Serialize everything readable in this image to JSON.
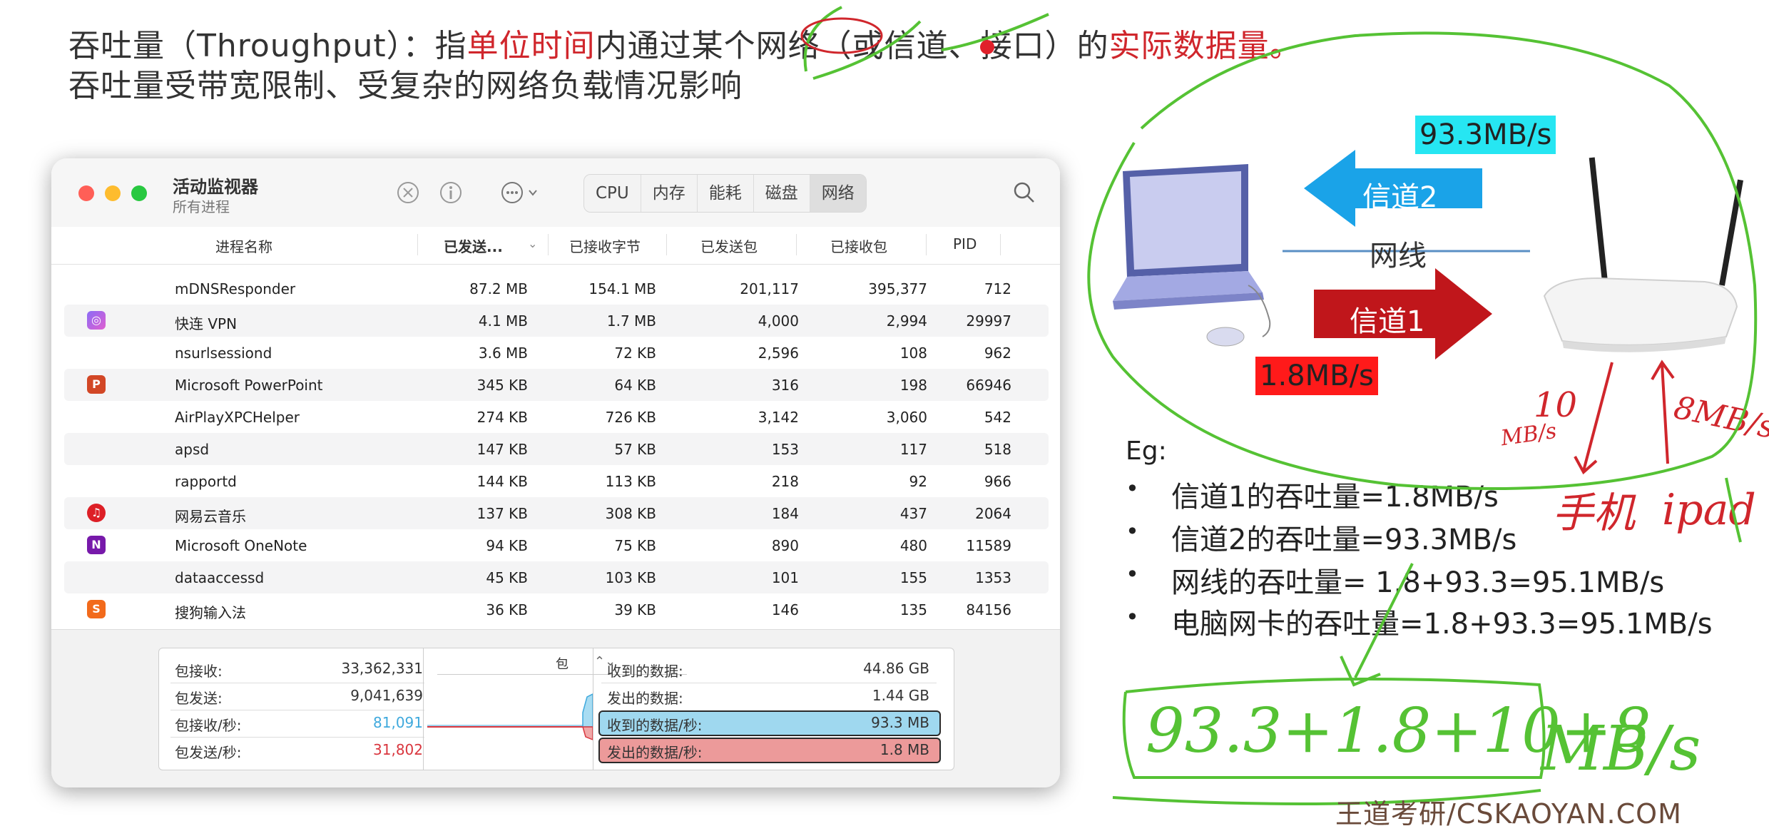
{
  "header": {
    "line1": [
      {
        "text": "吞吐量（Throughput）：指",
        "color": "normal"
      },
      {
        "text": "单位时间",
        "color": "red"
      },
      {
        "text": "内通过某个网络（或信道、接口）的",
        "color": "normal"
      },
      {
        "text": "实际数据量",
        "color": "red"
      },
      {
        "text": "。",
        "color": "red"
      }
    ],
    "line2": "吞吐量受带宽限制、受复杂的网络负载情况影响"
  },
  "window": {
    "title": "活动监视器",
    "subtitle": "所有进程",
    "tabs": [
      "CPU",
      "内存",
      "能耗",
      "磁盘",
      "网络"
    ],
    "active_tab": "网络",
    "columns": [
      "进程名称",
      "已发送...",
      "已接收字节",
      "已发送包",
      "已接收包",
      "PID"
    ],
    "processes": [
      {
        "name": "mDNSResponder",
        "icon": "",
        "sent": "87.2 MB",
        "recv": "154.1 MB",
        "pkt_out": "201,117",
        "pkt_in": "395,377",
        "pid": "712"
      },
      {
        "name": "快连 VPN",
        "icon": "vpn-app-icon",
        "sent": "4.1 MB",
        "recv": "1.7 MB",
        "pkt_out": "4,000",
        "pkt_in": "2,994",
        "pid": "29997"
      },
      {
        "name": "nsurlsessiond",
        "icon": "",
        "sent": "3.6 MB",
        "recv": "72 KB",
        "pkt_out": "2,596",
        "pkt_in": "108",
        "pid": "962"
      },
      {
        "name": "Microsoft PowerPoint",
        "icon": "powerpoint-icon",
        "sent": "345 KB",
        "recv": "64 KB",
        "pkt_out": "316",
        "pkt_in": "198",
        "pid": "66946"
      },
      {
        "name": "AirPlayXPCHelper",
        "icon": "",
        "sent": "274 KB",
        "recv": "726 KB",
        "pkt_out": "3,142",
        "pkt_in": "3,060",
        "pid": "542"
      },
      {
        "name": "apsd",
        "icon": "",
        "sent": "147 KB",
        "recv": "57 KB",
        "pkt_out": "153",
        "pkt_in": "117",
        "pid": "518"
      },
      {
        "name": "rapportd",
        "icon": "",
        "sent": "144 KB",
        "recv": "113 KB",
        "pkt_out": "218",
        "pkt_in": "92",
        "pid": "966"
      },
      {
        "name": "网易云音乐",
        "icon": "netease-music-icon",
        "sent": "137 KB",
        "recv": "308 KB",
        "pkt_out": "184",
        "pkt_in": "437",
        "pid": "2064"
      },
      {
        "name": "Microsoft OneNote",
        "icon": "onenote-icon",
        "sent": "94 KB",
        "recv": "75 KB",
        "pkt_out": "890",
        "pkt_in": "480",
        "pid": "11589"
      },
      {
        "name": "dataaccessd",
        "icon": "",
        "sent": "45 KB",
        "recv": "103 KB",
        "pkt_out": "101",
        "pkt_in": "155",
        "pid": "1353"
      },
      {
        "name": "搜狗输入法",
        "icon": "sogou-input-icon",
        "sent": "36 KB",
        "recv": "39 KB",
        "pkt_out": "146",
        "pkt_in": "135",
        "pid": "84156"
      }
    ],
    "stats_left": [
      {
        "label": "包接收:",
        "value": "33,362,331",
        "color": "#333333"
      },
      {
        "label": "包发送:",
        "value": "9,041,639",
        "color": "#333333"
      },
      {
        "label": "包接收/秒:",
        "value": "81,091",
        "color": "#3fa9dd"
      },
      {
        "label": "包发送/秒:",
        "value": "31,802",
        "color": "#d9363e"
      }
    ],
    "graph_selector": "包",
    "stats_right": [
      {
        "label": "收到的数据:",
        "value": "44.86 GB"
      },
      {
        "label": "发出的数据:",
        "value": "1.44 GB"
      },
      {
        "label": "收到的数据/秒:",
        "value": "93.3 MB"
      },
      {
        "label": "发出的数据/秒:",
        "value": "1.8 MB"
      }
    ]
  },
  "diagram": {
    "rate_top": "93.3MB/s",
    "channel2": "信道2",
    "cable": "网线",
    "channel1": "信道1",
    "rate_bottom": "1.8MB/s"
  },
  "examples": {
    "heading": "Eg:",
    "items": [
      "信道1的吞吐量=1.8MB/s",
      "信道2的吞吐量=93.3MB/s",
      "网线的吞吐量= 1.8+93.3=95.1MB/s",
      "电脑网卡的吞吐量=1.8+93.3=95.1MB/s"
    ]
  },
  "annotations": {
    "down_value": "10",
    "down_unit": "MB/s",
    "up_label": "8MB/s",
    "phone": "手机",
    "ipad": "ipad",
    "sum_expr": "93.3+1.8+10+8",
    "sum_unit": "MB/s"
  },
  "footer": "王道考研/CSKAOYAN.COM",
  "colors": {
    "red": "#d0262c",
    "green": "#55c234",
    "cyan": "#26e6f2",
    "arrow_blue": "#1aa3e8",
    "arrow_red": "#c0161b"
  }
}
